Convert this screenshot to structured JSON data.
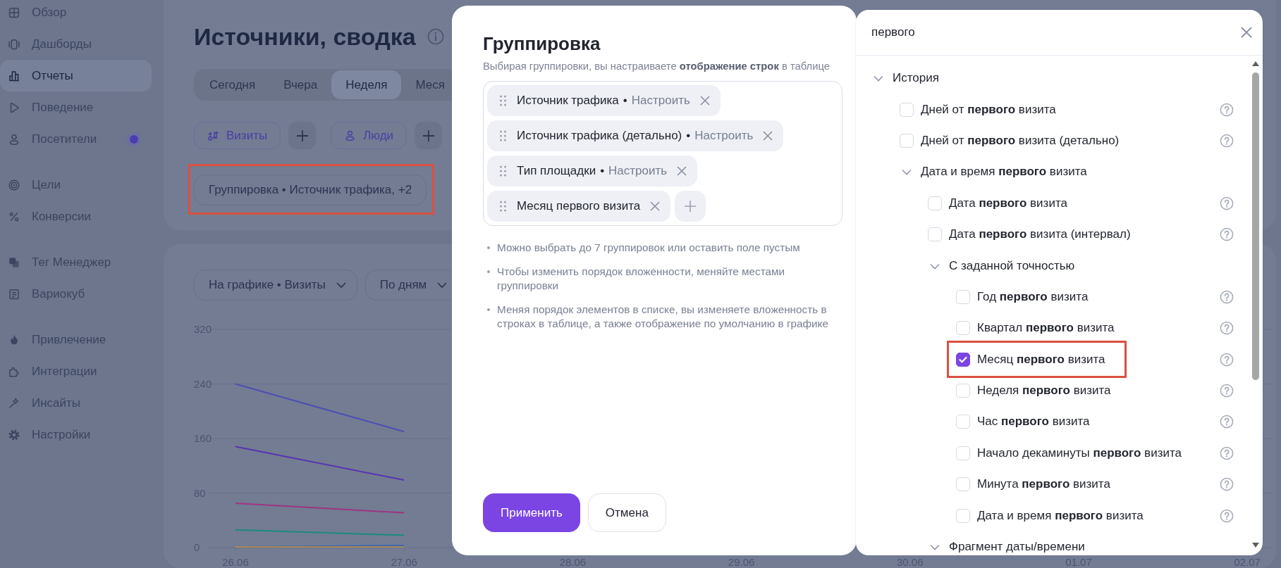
{
  "sidebar": {
    "sections": [
      {
        "items": [
          {
            "label": "Обзор",
            "selected": false
          },
          {
            "label": "Дашборды",
            "selected": false
          },
          {
            "label": "Отчеты",
            "selected": true
          },
          {
            "label": "Поведение",
            "selected": false
          },
          {
            "label": "Посетители",
            "selected": false,
            "notification": true
          }
        ]
      },
      {
        "items": [
          {
            "label": "Цели",
            "selected": false
          },
          {
            "label": "Конверсии",
            "selected": false
          }
        ]
      },
      {
        "items": [
          {
            "label": "Тег Менеджер",
            "selected": false
          },
          {
            "label": "Вариокуб",
            "selected": false
          }
        ]
      },
      {
        "items": [
          {
            "label": "Привлечение",
            "selected": false
          },
          {
            "label": "Интеграции",
            "selected": false
          },
          {
            "label": "Инсайты",
            "selected": false
          },
          {
            "label": "Настройки",
            "selected": false
          }
        ]
      }
    ]
  },
  "header": {
    "title": "Источники, сводка",
    "period_tabs": [
      {
        "label": "Сегодня",
        "selected": false
      },
      {
        "label": "Вчера",
        "selected": false
      },
      {
        "label": "Неделя",
        "selected": true
      },
      {
        "label": "Меся",
        "selected": false
      }
    ],
    "metric_buttons": [
      {
        "kind": "visits",
        "label": "Визиты"
      },
      {
        "kind": "add"
      },
      {
        "kind": "people",
        "label": "Люди"
      },
      {
        "kind": "add"
      }
    ],
    "grouping_button": {
      "label": "Группировка • Источник трафика, +2",
      "highlighted": true
    }
  },
  "chart_panel": {
    "dropdowns": [
      {
        "label": "На графике • Визиты"
      },
      {
        "label": "По дням"
      }
    ],
    "chart_data": {
      "type": "line",
      "grid": true,
      "categories": [
        "26.06",
        "27.06",
        "28.06",
        "29.06",
        "30.06",
        "01.07",
        "02.07"
      ],
      "ylim": [
        0,
        320
      ],
      "yticks": [
        0,
        80,
        160,
        240,
        320
      ],
      "series": [
        {
          "color": "#4d4fb4",
          "values": [
            240,
            170,
            null,
            null,
            null,
            null,
            null
          ]
        },
        {
          "color": "#5634b0",
          "values": [
            148,
            99,
            null,
            null,
            null,
            null,
            null
          ]
        },
        {
          "color": "#9e3582",
          "values": [
            65,
            51,
            null,
            null,
            null,
            null,
            null
          ]
        },
        {
          "color": "#1b8a82",
          "values": [
            26,
            18,
            null,
            null,
            null,
            null,
            null
          ]
        },
        {
          "color": "#3a66b0",
          "values": [
            1,
            3,
            null,
            null,
            null,
            null,
            null
          ]
        },
        {
          "color": "#a8875a",
          "values": [
            1,
            1,
            null,
            null,
            null,
            null,
            null
          ]
        }
      ]
    }
  },
  "dialog": {
    "title": "Группировка",
    "subtitle": "Выбирая группировки, вы настраиваете **отображение строк** в таблице",
    "chips": [
      {
        "label": "Источник трафика",
        "separator": "•",
        "action": "Настроить"
      },
      {
        "label": "Источник трафика (детально)",
        "separator": "•",
        "action": "Настроить"
      },
      {
        "label": "Тип площадки",
        "separator": "•",
        "action": "Настроить"
      },
      {
        "label": "Месяц первого визита"
      }
    ],
    "notes": [
      "Можно выбрать до 7 группировок или оставить поле пустым",
      "Чтобы изменить порядок вложенности, меняйте местами группировки",
      "Меняя порядок элементов в списке, вы изменяете вложенность в строках в таблице, а также отображение по умолчанию в графике"
    ],
    "buttons": [
      {
        "kind": "primary",
        "label": "Применить"
      },
      {
        "kind": "secondary",
        "label": "Отмена"
      }
    ]
  },
  "picker": {
    "search": {
      "value": "первого"
    },
    "tree": [
      {
        "kind": "group",
        "label": "История",
        "expanded": true,
        "children": [
          {
            "kind": "option",
            "label": "Дней от **первого** визита",
            "checked": false
          },
          {
            "kind": "option",
            "label": "Дней от **первого** визита (детально)",
            "checked": false
          },
          {
            "kind": "group",
            "label": "Дата и время **первого** визита",
            "expanded": true,
            "children": [
              {
                "kind": "option",
                "label": "Дата **первого** визита",
                "checked": false
              },
              {
                "kind": "option",
                "label": "Дата **первого** визита (интервал)",
                "checked": false
              },
              {
                "kind": "group",
                "label": "С заданной точностью",
                "expanded": true,
                "children": [
                  {
                    "kind": "option",
                    "label": "Год **первого** визита",
                    "checked": false
                  },
                  {
                    "kind": "option",
                    "label": "Квартал **первого** визита",
                    "checked": false
                  },
                  {
                    "kind": "option",
                    "label": "Месяц **первого** визита",
                    "checked": true,
                    "highlighted": true
                  },
                  {
                    "kind": "option",
                    "label": "Неделя **первого** визита",
                    "checked": false
                  },
                  {
                    "kind": "option",
                    "label": "Час **первого** визита",
                    "checked": false
                  },
                  {
                    "kind": "option",
                    "label": "Начало декаминуты **первого** визита",
                    "checked": false
                  },
                  {
                    "kind": "option",
                    "label": "Минута **первого** визита",
                    "checked": false
                  },
                  {
                    "kind": "option",
                    "label": "Дата и время **первого** визита",
                    "checked": false
                  }
                ]
              },
              {
                "kind": "group",
                "label": "Фрагмент даты/времени",
                "expanded": true
              }
            ]
          }
        ]
      }
    ]
  }
}
